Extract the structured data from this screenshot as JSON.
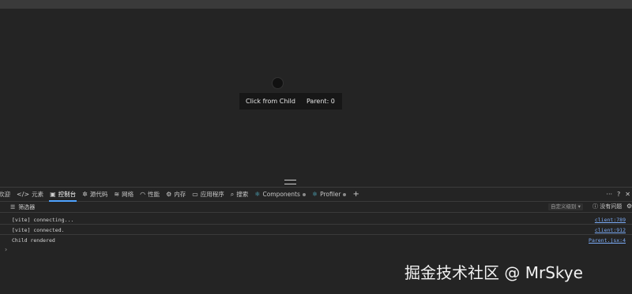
{
  "app": {
    "click_button": "Click from Child",
    "parent_label": "Parent: 0"
  },
  "devtools": {
    "tabs": [
      {
        "label": "欢迎",
        "icon": "welcome-icon"
      },
      {
        "label": "元素",
        "icon": "elements-icon"
      },
      {
        "label": "控制台",
        "icon": "console-icon",
        "active": true
      },
      {
        "label": "源代码",
        "icon": "bug-icon"
      },
      {
        "label": "网络",
        "icon": "wifi-icon"
      },
      {
        "label": "性能",
        "icon": "performance-icon"
      },
      {
        "label": "内存",
        "icon": "memory-icon"
      },
      {
        "label": "应用程序",
        "icon": "application-icon"
      },
      {
        "label": "搜索",
        "icon": "search-icon"
      },
      {
        "label": "Components",
        "icon": "react-icon"
      },
      {
        "label": "Profiler",
        "icon": "react-icon"
      }
    ],
    "filter_placeholder": "筛选器",
    "levels_label": "自定义级别",
    "issues_label": "没有问题",
    "logs": [
      {
        "message": "[vite] connecting...",
        "source": "client:789"
      },
      {
        "message": "[vite] connected.",
        "source": "client:912"
      },
      {
        "message": "Child rendered",
        "source": "Parent.jsx:4"
      }
    ],
    "prompt": "›",
    "accent_color": "#4fa3ff"
  },
  "watermark": "掘金技术社区 @ MrSkye"
}
